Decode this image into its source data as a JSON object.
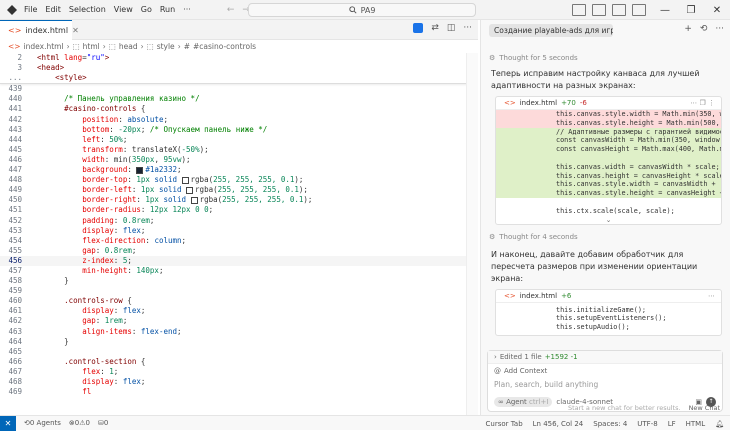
{
  "menu": [
    "File",
    "Edit",
    "Selection",
    "View",
    "Go",
    "Run"
  ],
  "more_label": "···",
  "search_label": "PA9",
  "tab": {
    "label": "index.html"
  },
  "breadcrumb": [
    "index.html",
    "html",
    "head",
    "style",
    "#casino-controls"
  ],
  "sticky_lines": [
    {
      "n": "2",
      "segs": [
        {
          "t": "  ",
          "c": "p"
        },
        {
          "t": "<html",
          "c": "tag"
        },
        {
          "t": " lang",
          "c": "attr"
        },
        {
          "t": "=",
          "c": "p"
        },
        {
          "t": "\"ru\"",
          "c": "str"
        },
        {
          "t": ">",
          "c": "tag"
        }
      ]
    },
    {
      "n": "3",
      "segs": [
        {
          "t": "  ",
          "c": "p"
        },
        {
          "t": "<head>",
          "c": "tag"
        }
      ]
    },
    {
      "n": "...",
      "segs": [
        {
          "t": "      ",
          "c": "p"
        },
        {
          "t": "<style>",
          "c": "tag"
        }
      ]
    }
  ],
  "code_lines": [
    {
      "n": "439",
      "segs": []
    },
    {
      "n": "440",
      "segs": [
        {
          "t": "        ",
          "c": "p"
        },
        {
          "t": "/* Панель управления казино */",
          "c": "cm"
        }
      ]
    },
    {
      "n": "441",
      "segs": [
        {
          "t": "        ",
          "c": "p"
        },
        {
          "t": "#casino-controls",
          "c": "sel"
        },
        {
          "t": " {",
          "c": "p"
        }
      ]
    },
    {
      "n": "442",
      "segs": [
        {
          "t": "            ",
          "c": "p"
        },
        {
          "t": "position",
          "c": "prop"
        },
        {
          "t": ": ",
          "c": "p"
        },
        {
          "t": "absolute",
          "c": "val"
        },
        {
          "t": ";",
          "c": "p"
        }
      ]
    },
    {
      "n": "443",
      "segs": [
        {
          "t": "            ",
          "c": "p"
        },
        {
          "t": "bottom",
          "c": "prop"
        },
        {
          "t": ": ",
          "c": "p"
        },
        {
          "t": "-20px",
          "c": "num"
        },
        {
          "t": "; ",
          "c": "p"
        },
        {
          "t": "/* Опускаем панель ниже */",
          "c": "cm"
        }
      ]
    },
    {
      "n": "444",
      "segs": [
        {
          "t": "            ",
          "c": "p"
        },
        {
          "t": "left",
          "c": "prop"
        },
        {
          "t": ": ",
          "c": "p"
        },
        {
          "t": "50%",
          "c": "num"
        },
        {
          "t": ";",
          "c": "p"
        }
      ]
    },
    {
      "n": "445",
      "segs": [
        {
          "t": "            ",
          "c": "p"
        },
        {
          "t": "transform",
          "c": "prop"
        },
        {
          "t": ": translateX(",
          "c": "p"
        },
        {
          "t": "-50%",
          "c": "num"
        },
        {
          "t": ");",
          "c": "p"
        }
      ]
    },
    {
      "n": "446",
      "segs": [
        {
          "t": "            ",
          "c": "p"
        },
        {
          "t": "width",
          "c": "prop"
        },
        {
          "t": ": min(",
          "c": "p"
        },
        {
          "t": "350px",
          "c": "num"
        },
        {
          "t": ", ",
          "c": "p"
        },
        {
          "t": "95vw",
          "c": "num"
        },
        {
          "t": ");",
          "c": "p"
        }
      ]
    },
    {
      "n": "447",
      "segs": [
        {
          "t": "            ",
          "c": "p"
        },
        {
          "t": "background",
          "c": "prop"
        },
        {
          "t": ": ",
          "c": "p"
        },
        {
          "sw": "#1a2332"
        },
        {
          "t": "#1a2332",
          "c": "val"
        },
        {
          "t": ";",
          "c": "p"
        }
      ]
    },
    {
      "n": "448",
      "segs": [
        {
          "t": "            ",
          "c": "p"
        },
        {
          "t": "border-top",
          "c": "prop"
        },
        {
          "t": ": ",
          "c": "p"
        },
        {
          "t": "1px",
          "c": "num"
        },
        {
          "t": " solid ",
          "c": "val"
        },
        {
          "sw": "#ffffff"
        },
        {
          "t": "rgba(",
          "c": "p"
        },
        {
          "t": "255, 255, 255, 0.1",
          "c": "num"
        },
        {
          "t": ");",
          "c": "p"
        }
      ]
    },
    {
      "n": "449",
      "segs": [
        {
          "t": "            ",
          "c": "p"
        },
        {
          "t": "border-left",
          "c": "prop"
        },
        {
          "t": ": ",
          "c": "p"
        },
        {
          "t": "1px",
          "c": "num"
        },
        {
          "t": " solid ",
          "c": "val"
        },
        {
          "sw": "#ffffff"
        },
        {
          "t": "rgba(",
          "c": "p"
        },
        {
          "t": "255, 255, 255, 0.1",
          "c": "num"
        },
        {
          "t": ");",
          "c": "p"
        }
      ]
    },
    {
      "n": "450",
      "segs": [
        {
          "t": "            ",
          "c": "p"
        },
        {
          "t": "border-right",
          "c": "prop"
        },
        {
          "t": ": ",
          "c": "p"
        },
        {
          "t": "1px",
          "c": "num"
        },
        {
          "t": " solid ",
          "c": "val"
        },
        {
          "sw": "#ffffff"
        },
        {
          "t": "rgba(",
          "c": "p"
        },
        {
          "t": "255, 255, 255, 0.1",
          "c": "num"
        },
        {
          "t": ");",
          "c": "p"
        }
      ]
    },
    {
      "n": "451",
      "segs": [
        {
          "t": "            ",
          "c": "p"
        },
        {
          "t": "border-radius",
          "c": "prop"
        },
        {
          "t": ": ",
          "c": "p"
        },
        {
          "t": "12px 12px 0 0",
          "c": "num"
        },
        {
          "t": ";",
          "c": "p"
        }
      ]
    },
    {
      "n": "452",
      "segs": [
        {
          "t": "            ",
          "c": "p"
        },
        {
          "t": "padding",
          "c": "prop"
        },
        {
          "t": ": ",
          "c": "p"
        },
        {
          "t": "0.8rem",
          "c": "num"
        },
        {
          "t": ";",
          "c": "p"
        }
      ]
    },
    {
      "n": "453",
      "segs": [
        {
          "t": "            ",
          "c": "p"
        },
        {
          "t": "display",
          "c": "prop"
        },
        {
          "t": ": ",
          "c": "p"
        },
        {
          "t": "flex",
          "c": "val"
        },
        {
          "t": ";",
          "c": "p"
        }
      ]
    },
    {
      "n": "454",
      "segs": [
        {
          "t": "            ",
          "c": "p"
        },
        {
          "t": "flex-direction",
          "c": "prop"
        },
        {
          "t": ": ",
          "c": "p"
        },
        {
          "t": "column",
          "c": "val"
        },
        {
          "t": ";",
          "c": "p"
        }
      ]
    },
    {
      "n": "455",
      "segs": [
        {
          "t": "            ",
          "c": "p"
        },
        {
          "t": "gap",
          "c": "prop"
        },
        {
          "t": ": ",
          "c": "p"
        },
        {
          "t": "0.8rem",
          "c": "num"
        },
        {
          "t": ";",
          "c": "p"
        }
      ]
    },
    {
      "n": "456",
      "active": true,
      "segs": [
        {
          "t": "            ",
          "c": "p"
        },
        {
          "t": "z-index",
          "c": "prop"
        },
        {
          "t": ": ",
          "c": "p"
        },
        {
          "t": "5",
          "c": "num"
        },
        {
          "t": ";",
          "c": "p"
        }
      ]
    },
    {
      "n": "457",
      "segs": [
        {
          "t": "            ",
          "c": "p"
        },
        {
          "t": "min-height",
          "c": "prop"
        },
        {
          "t": ": ",
          "c": "p"
        },
        {
          "t": "140px",
          "c": "num"
        },
        {
          "t": ";",
          "c": "p"
        }
      ]
    },
    {
      "n": "458",
      "segs": [
        {
          "t": "        ",
          "c": "p"
        },
        {
          "t": "}",
          "c": "p"
        }
      ]
    },
    {
      "n": "459",
      "segs": []
    },
    {
      "n": "460",
      "segs": [
        {
          "t": "        ",
          "c": "p"
        },
        {
          "t": ".controls-row",
          "c": "sel"
        },
        {
          "t": " {",
          "c": "p"
        }
      ]
    },
    {
      "n": "461",
      "segs": [
        {
          "t": "            ",
          "c": "p"
        },
        {
          "t": "display",
          "c": "prop"
        },
        {
          "t": ": ",
          "c": "p"
        },
        {
          "t": "flex",
          "c": "val"
        },
        {
          "t": ";",
          "c": "p"
        }
      ]
    },
    {
      "n": "462",
      "segs": [
        {
          "t": "            ",
          "c": "p"
        },
        {
          "t": "gap",
          "c": "prop"
        },
        {
          "t": ": ",
          "c": "p"
        },
        {
          "t": "1rem",
          "c": "num"
        },
        {
          "t": ";",
          "c": "p"
        }
      ]
    },
    {
      "n": "463",
      "segs": [
        {
          "t": "            ",
          "c": "p"
        },
        {
          "t": "align-items",
          "c": "prop"
        },
        {
          "t": ": ",
          "c": "p"
        },
        {
          "t": "flex-end",
          "c": "val"
        },
        {
          "t": ";",
          "c": "p"
        }
      ]
    },
    {
      "n": "464",
      "segs": [
        {
          "t": "        ",
          "c": "p"
        },
        {
          "t": "}",
          "c": "p"
        }
      ]
    },
    {
      "n": "465",
      "segs": []
    },
    {
      "n": "466",
      "segs": [
        {
          "t": "        ",
          "c": "p"
        },
        {
          "t": ".control-section",
          "c": "sel"
        },
        {
          "t": " {",
          "c": "p"
        }
      ]
    },
    {
      "n": "467",
      "segs": [
        {
          "t": "            ",
          "c": "p"
        },
        {
          "t": "flex",
          "c": "prop"
        },
        {
          "t": ": ",
          "c": "p"
        },
        {
          "t": "1",
          "c": "num"
        },
        {
          "t": ";",
          "c": "p"
        }
      ]
    },
    {
      "n": "468",
      "segs": [
        {
          "t": "            ",
          "c": "p"
        },
        {
          "t": "display",
          "c": "prop"
        },
        {
          "t": ": ",
          "c": "p"
        },
        {
          "t": "flex",
          "c": "val"
        },
        {
          "t": ";",
          "c": "p"
        }
      ]
    },
    {
      "n": "469",
      "segs": [
        {
          "t": "            ",
          "c": "p"
        },
        {
          "t": "fl",
          "c": "prop"
        }
      ]
    }
  ],
  "chat": {
    "title": "Создание playable-ads для игры Пл",
    "thought1": "Thought for 5 seconds",
    "msg1": "Теперь исправим настройку канваса для лучшей адаптивности на разных экранах:",
    "diff1_file": "index.html",
    "diff1_add": "+70",
    "diff1_del": "-6",
    "diff1_lines": [
      {
        "k": "del",
        "t": "this.canvas.style.width = Math.min(350, win"
      },
      {
        "k": "del",
        "t": "this.canvas.style.height = Math.min(500, win"
      },
      {
        "k": "add",
        "t": "// Адаптивные размеры с гарантией видимост"
      },
      {
        "k": "add",
        "t": "const canvasWidth = Math.min(350, window.inn"
      },
      {
        "k": "add",
        "t": "const canvasHeight = Math.max(400, Math.min"
      },
      {
        "k": "add",
        "t": ""
      },
      {
        "k": "add",
        "t": "this.canvas.width = canvasWidth * scale;"
      },
      {
        "k": "add",
        "t": "this.canvas.height = canvasHeight * scale;"
      },
      {
        "k": "add",
        "t": "this.canvas.style.width = canvasWidth + 'px"
      },
      {
        "k": "add",
        "t": "this.canvas.style.height = canvasHeight + 'p"
      },
      {
        "k": "ctx",
        "t": ""
      },
      {
        "k": "ctx",
        "t": "this.ctx.scale(scale, scale);"
      }
    ],
    "thought2": "Thought for 4 seconds",
    "msg2": "И наконец, давайте добавим обработчик для пересчета размеров при изменении ориентации экрана:",
    "diff2_file": "index.html",
    "diff2_add": "+6",
    "diff2_lines": [
      {
        "k": "ctx",
        "t": "this.initializeGame();"
      },
      {
        "k": "ctx",
        "t": "this.setupEventListeners();"
      },
      {
        "k": "ctx",
        "t": "this.setupAudio();"
      }
    ],
    "edited": "Edited 1 file",
    "edited_stats": "+1592 -1",
    "add_context": "Add Context",
    "placeholder": "Plan, search, build anything",
    "agent_label": "Agent",
    "agent_shortcut": "ctrl+I",
    "model": "claude-4-sonnet",
    "footer_hint": "Start a new chat for better results.",
    "new_chat": "New Chat"
  },
  "status": {
    "errors": "0",
    "warnings": "0",
    "agents": "0 Agents",
    "ports": "0",
    "cursor_tab": "Cursor Tab",
    "position": "Ln 456, Col 24",
    "spaces": "Spaces: 4",
    "encoding": "UTF-8",
    "eol": "LF",
    "language": "HTML"
  },
  "colors": {
    "accent": "#0066b8",
    "diff_del": "#fddada",
    "diff_add": "#dff0c8"
  }
}
